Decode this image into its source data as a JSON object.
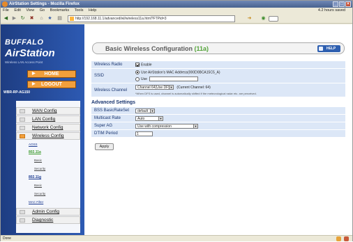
{
  "window": {
    "title": "AirStation Settings - Mozilla Firefox"
  },
  "menubar": {
    "items": [
      "File",
      "Edit",
      "View",
      "Go",
      "Bookmarks",
      "Tools",
      "Help"
    ],
    "right_text": "4.2 hours saved"
  },
  "address": {
    "url": "http://192.168.11.1/advanced/wl/wireless11a.html?FTPid=3"
  },
  "sidebar": {
    "logo_top": "BUFFALO",
    "logo_main": "AirStation",
    "logo_tagline": "Wireless LAN Access Point",
    "home_label": "HOME",
    "logout_label": "LOGOUT",
    "model": "WBR-RP-AG150",
    "menu": [
      {
        "label": "WAN Config"
      },
      {
        "label": "LAN Config"
      },
      {
        "label": "Network Config"
      },
      {
        "label": "Wireless Config"
      }
    ],
    "sub": {
      "aoss": "AOSS",
      "band_a": "802.11a",
      "a_basic": "Basic",
      "a_security": "Security",
      "band_g": "802.11g",
      "g_basic": "Basic",
      "g_security": "Security",
      "mac": "MAC Filter"
    },
    "bottom_menu": [
      {
        "label": "Admin Config"
      },
      {
        "label": "Diagnostic"
      }
    ]
  },
  "page": {
    "title": "Basic Wireless Configuration",
    "title_band": "(11a)",
    "help_label": "HELP",
    "wireless_radio": {
      "label": "Wireless Radio",
      "option": "Enable"
    },
    "ssid": {
      "label": "SSID",
      "option_default": "Use AirStation's MAC Address(000D0BCA15C5_A)",
      "option_custom": "Use",
      "custom_value": ""
    },
    "channel": {
      "label": "Wireless Channel",
      "value": "Channel 64(Use DFS)",
      "current": "(Current Channel: 64)",
      "note": "*When DFS is used, channel is automatically shifted if the meteorological radar etc. are perceived."
    },
    "advanced": {
      "heading": "Advanced Settings",
      "bss": {
        "label": "BSS BasicRateSet",
        "value": "default"
      },
      "multicast": {
        "label": "Multicast Rate",
        "value": "Auto"
      },
      "super_ag": {
        "label": "Super AG",
        "value": "Use with compression"
      },
      "dtim": {
        "label": "DTIM Period",
        "value": "1"
      }
    },
    "apply_label": "Apply"
  },
  "statusbar": {
    "text": "Done"
  },
  "colors": {
    "sidebar": "#2d5ab3",
    "accent": "#f29f3b",
    "row": "#dce7f7",
    "band": "#54a43a"
  }
}
